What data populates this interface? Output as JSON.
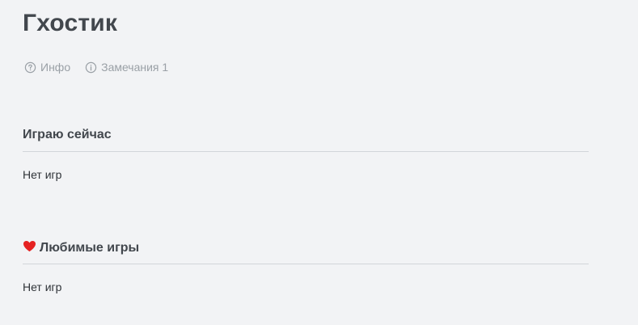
{
  "profile": {
    "name": "Гхостик"
  },
  "tabs": [
    {
      "label": "Инфо",
      "icon": "question-circle-icon"
    },
    {
      "label": "Замечания 1",
      "icon": "info-circle-icon"
    }
  ],
  "sections": {
    "playing_now": {
      "title": "Играю сейчас",
      "empty_text": "Нет игр"
    },
    "favorite_games": {
      "title": "Любимые игры",
      "icon": "heart-icon",
      "icon_color": "#e52222",
      "empty_text": "Нет игр"
    }
  },
  "colors": {
    "background": "#f2f3f5",
    "muted_text": "#9aa0a6",
    "heading": "#42474d"
  }
}
